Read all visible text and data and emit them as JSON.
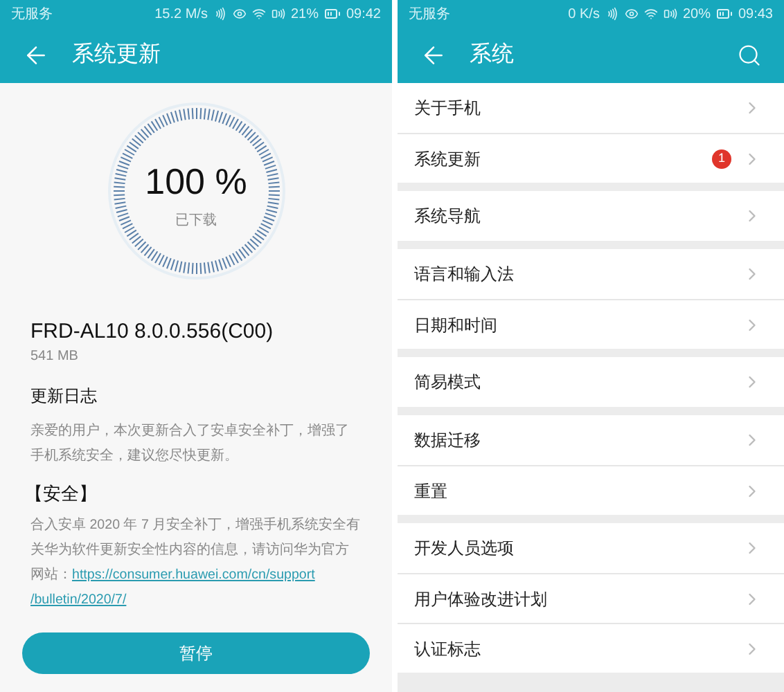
{
  "left_screen": {
    "status_bar": {
      "carrier": "无服务",
      "speed": "15.2 M/s",
      "battery": "21%",
      "time": "09:42"
    },
    "title": "系统更新",
    "progress": {
      "percent": "100 %",
      "caption": "已下载"
    },
    "package": {
      "name": "FRD-AL10 8.0.0.556(C00)",
      "size": "541 MB"
    },
    "changelog": {
      "heading": "更新日志",
      "intro": "亲爱的用户，本次更新合入了安卓安全补丁，增强了手机系统安全，建议您尽快更新。",
      "section_heading": "【安全】",
      "section_text": "合入安卓 2020 年 7 月安全补丁，增强手机系统安全有关华为软件更新安全性内容的信息，请访问华为官方网站：",
      "link_lines": [
        "https://consumer.huawei.com/cn/support",
        "/bulletin/2020/7/"
      ]
    },
    "pause_button": "暂停"
  },
  "right_screen": {
    "status_bar": {
      "carrier": "无服务",
      "speed": "0 K/s",
      "battery": "20%",
      "time": "09:43"
    },
    "title": "系统",
    "sections": [
      [
        {
          "label": "关于手机"
        },
        {
          "label": "系统更新",
          "badge": "1"
        }
      ],
      [
        {
          "label": "系统导航"
        }
      ],
      [
        {
          "label": "语言和输入法"
        },
        {
          "label": "日期和时间"
        }
      ],
      [
        {
          "label": "简易模式"
        }
      ],
      [
        {
          "label": "数据迁移"
        },
        {
          "label": "重置"
        }
      ],
      [
        {
          "label": "开发人员选项"
        },
        {
          "label": "用户体验改进计划"
        },
        {
          "label": "认证标志"
        }
      ]
    ]
  }
}
